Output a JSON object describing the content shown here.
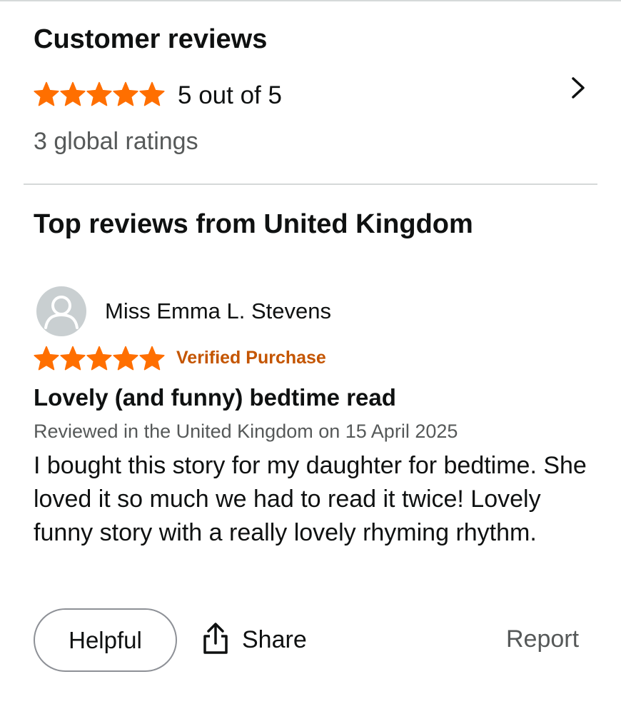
{
  "summary": {
    "title": "Customer reviews",
    "rating": 5,
    "rating_max": 5,
    "rating_text": "5 out of 5",
    "global_ratings": "3 global ratings"
  },
  "top_reviews": {
    "title": "Top reviews from United Kingdom"
  },
  "review": {
    "author": "Miss Emma L. Stevens",
    "rating": 5,
    "rating_max": 5,
    "verified_label": "Verified Purchase",
    "title": "Lovely (and funny) bedtime read",
    "meta": "Reviewed in the United Kingdom on 15 April 2025",
    "body": "I bought this story for my daughter for bedtime. She loved it so much we had to read it twice! Lovely funny story with a really lovely rhyming rhythm.",
    "actions": {
      "helpful_label": "Helpful",
      "share_label": "Share",
      "report_label": "Report"
    }
  },
  "colors": {
    "star": "#ff6f00",
    "verified": "#c45500",
    "muted_text": "#565959",
    "divider": "#d5d9d9"
  },
  "icons": {
    "star": "star-icon",
    "chevron": "chevron-right-icon",
    "avatar": "user-avatar-icon",
    "share": "share-icon"
  }
}
